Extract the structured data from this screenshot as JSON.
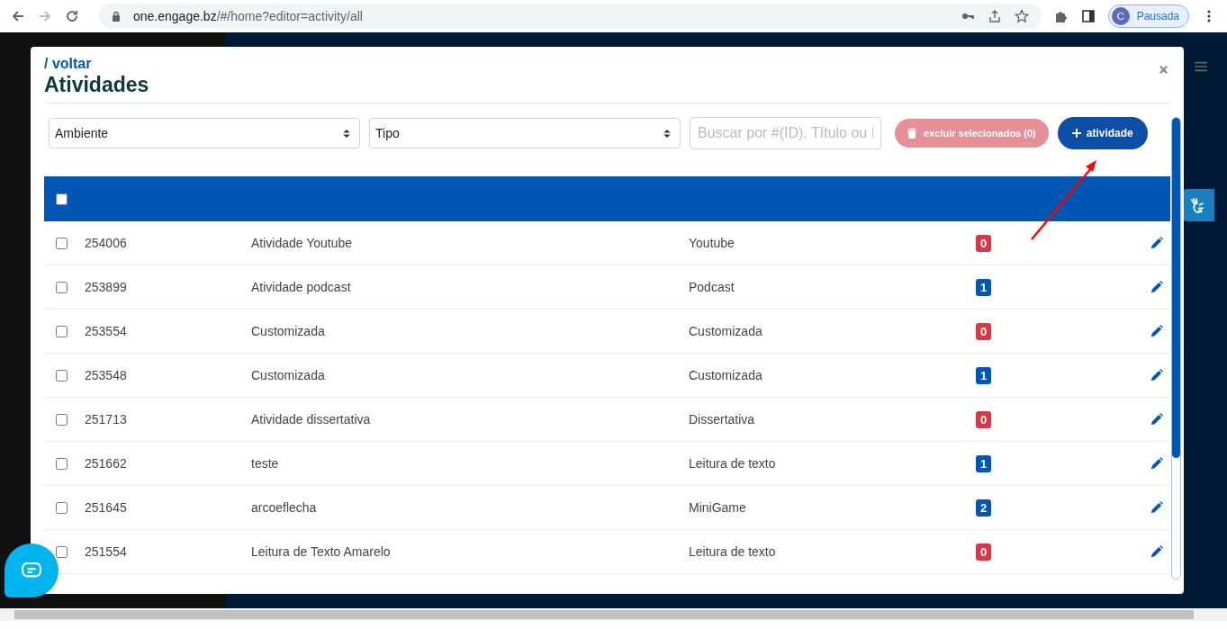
{
  "browser": {
    "url_host": "one.engage.bz",
    "url_path": "/#/home?editor=activity/all",
    "profile_initial": "C",
    "profile_label": "Pausada"
  },
  "modal": {
    "back_link": "/ voltar",
    "title": "Atividades",
    "filters": [
      {
        "kind": "select",
        "value": "Ambiente"
      },
      {
        "kind": "select",
        "value": "Tipo"
      },
      {
        "kind": "search",
        "placeholder": "Buscar por #(ID), Título ou I"
      }
    ],
    "delete_button": {
      "label": "excluir selecionados (0)",
      "disabled": true
    },
    "add_button": {
      "label": "atividade"
    },
    "select_all_checked": false,
    "rows": [
      {
        "checked": false,
        "id": "254006",
        "title": "Atividade Youtube",
        "type": "Youtube",
        "count": "0",
        "color": "#dc3545"
      },
      {
        "checked": false,
        "id": "253899",
        "title": "Atividade podcast",
        "type": "Podcast",
        "count": "1",
        "color": "#0056b3"
      },
      {
        "checked": false,
        "id": "253554",
        "title": "Customizada",
        "type": "Customizada",
        "count": "0",
        "color": "#dc3545"
      },
      {
        "checked": false,
        "id": "253548",
        "title": "Customizada",
        "type": "Customizada",
        "count": "1",
        "color": "#0056b3"
      },
      {
        "checked": false,
        "id": "251713",
        "title": "Atividade dissertativa",
        "type": "Dissertativa",
        "count": "0",
        "color": "#dc3545"
      },
      {
        "checked": false,
        "id": "251662",
        "title": "teste",
        "type": "Leitura de texto",
        "count": "1",
        "color": "#0056b3"
      },
      {
        "checked": false,
        "id": "251645",
        "title": "arcoeflecha",
        "type": "MiniGame",
        "count": "2",
        "color": "#0056b3"
      },
      {
        "checked": false,
        "id": "251554",
        "title": "Leitura de Texto Amarelo",
        "type": "Leitura de texto",
        "count": "0",
        "color": "#dc3545"
      }
    ]
  }
}
